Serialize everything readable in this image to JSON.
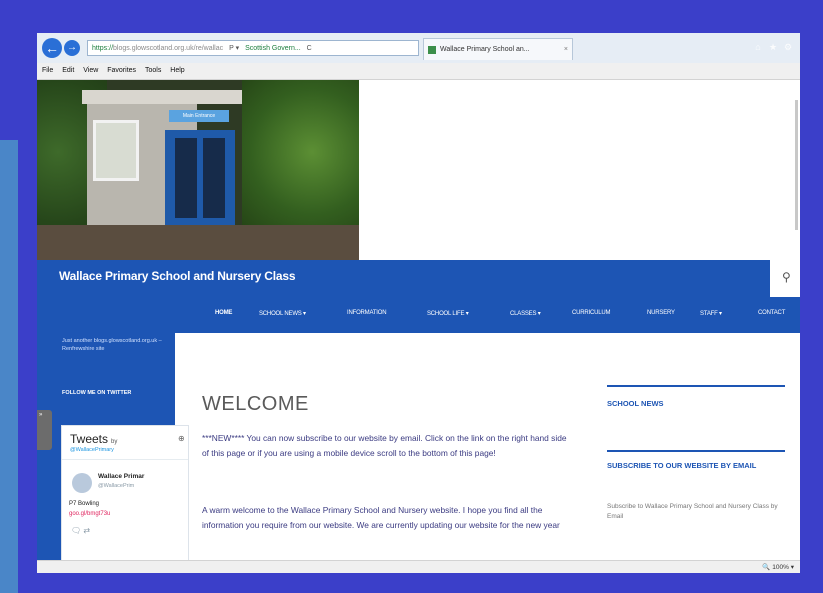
{
  "browser": {
    "address": {
      "secure": "https://",
      "url": "blogs.glowscotland.org.uk/re/wallac",
      "search": "P ▾",
      "cert": "Scottish Govern...",
      "refresh": "C"
    },
    "tab": {
      "title": "Wallace Primary School an...",
      "close": "×"
    },
    "menu": [
      "File",
      "Edit",
      "View",
      "Favorites",
      "Tools",
      "Help"
    ],
    "window_controls": [
      "⌂",
      "★",
      "⚙"
    ],
    "zoom": "🔍 100%  ▾"
  },
  "site": {
    "title": "Wallace Primary School and Nursery Class",
    "search_icon": "search-icon",
    "nav": [
      "HOME",
      "SCHOOL NEWS ▾",
      "INFORMATION",
      "SCHOOL LIFE ▾",
      "CLASSES ▾",
      "CURRICULUM",
      "NURSERY",
      "STAFF ▾",
      "CONTACT"
    ],
    "sidebar_text": "Just another blogs.glowscotland.org.uk – Renfrewshire site",
    "follow": "FOLLOW ME ON TWITTER",
    "hero_sign": "Main Entrance"
  },
  "twitter": {
    "title": "Tweets",
    "by": "by",
    "handle": "@WallacePrimary",
    "name": "Wallace Primar",
    "sub_handle": "@WallacePrim",
    "body": "P7 Bowling",
    "link": "goo.gl/bmgt73u",
    "icons": "🗨   ⇄"
  },
  "main": {
    "heading": "WELCOME",
    "para1": "***NEW**** You can now subscribe to our website by email. Click on the link on the right hand side of this page or if you are using a mobile device scroll to the bottom of this page!",
    "para2": "A warm welcome to the Wallace Primary School and Nursery website. I hope you find all the information you require from our website. We are currently updating our website for the new year"
  },
  "right": {
    "news": "SCHOOL NEWS",
    "subscribe": "SUBSCRIBE TO OUR WEBSITE BY EMAIL",
    "subscribe_text": "Subscribe to Wallace Primary School and Nursery Class by Email"
  },
  "colors": {
    "brand": "#1d55b4",
    "slide_bg": "#3b3fc9"
  }
}
